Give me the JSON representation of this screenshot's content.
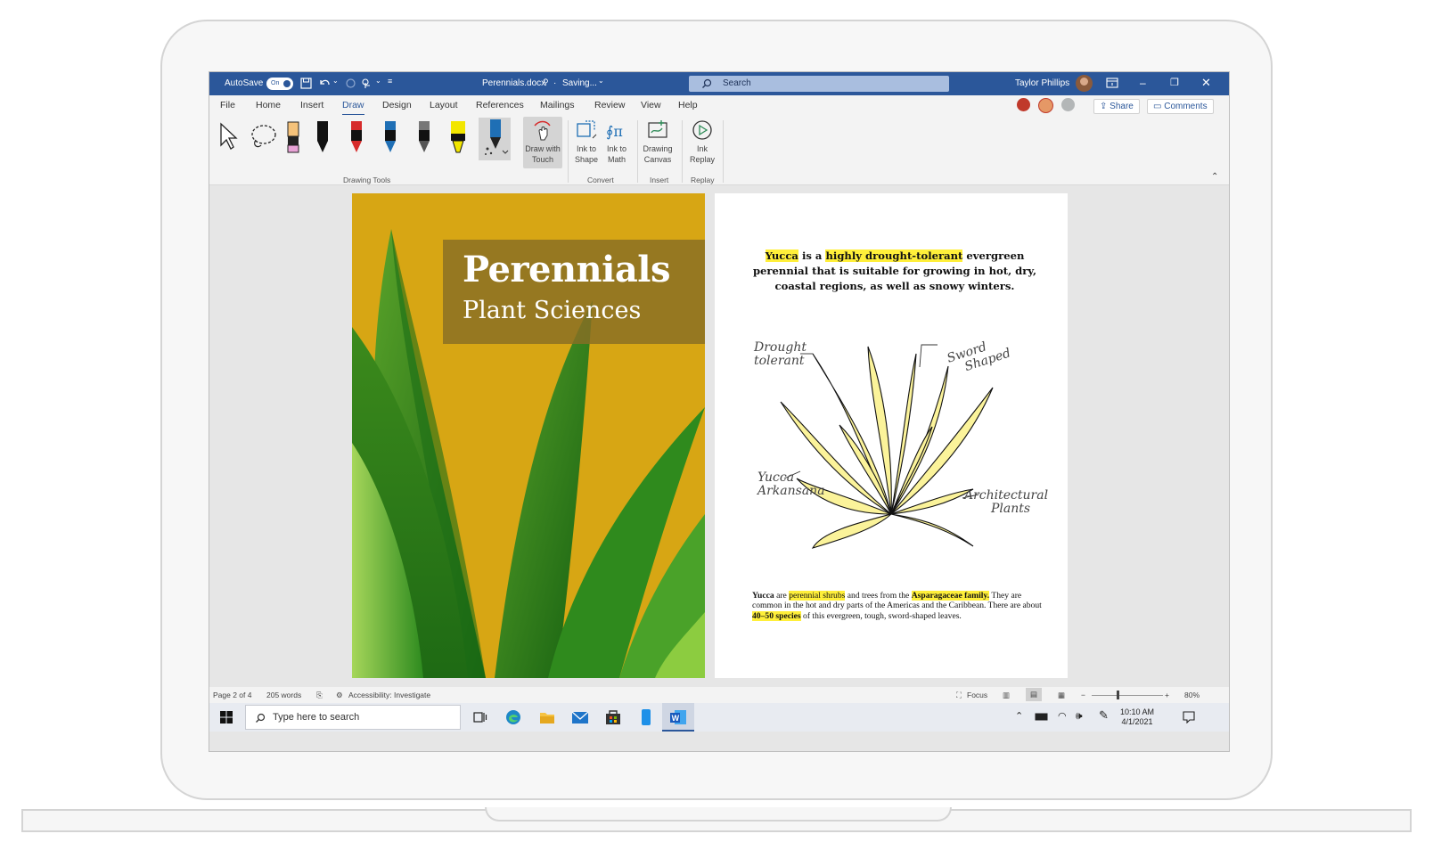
{
  "titlebar": {
    "autosave_label": "AutoSave",
    "autosave_state": "On",
    "doc_name": "Perennials.docx",
    "save_status": "Saving...",
    "search_placeholder": "Search",
    "user_name": "Taylor Phillips",
    "accent_color": "#2b579a"
  },
  "menu": {
    "items": [
      "File",
      "Home",
      "Insert",
      "Draw",
      "Design",
      "Layout",
      "References",
      "Mailings",
      "Review",
      "View",
      "Help"
    ],
    "active": "Draw",
    "share_label": "Share",
    "comments_label": "Comments"
  },
  "ribbon": {
    "draw_with_touch": [
      "Draw with",
      "Touch"
    ],
    "ink_to_shape": [
      "Ink to",
      "Shape"
    ],
    "ink_to_math": [
      "Ink to",
      "Math"
    ],
    "drawing_canvas": [
      "Drawing",
      "Canvas"
    ],
    "ink_replay": [
      "Ink",
      "Replay"
    ],
    "groups": {
      "drawing_tools": "Drawing Tools",
      "convert": "Convert",
      "insert": "Insert",
      "replay": "Replay"
    },
    "pen_colors": [
      "#f5c27a",
      "#111111",
      "#d62b2b",
      "#1f6fb5",
      "#555555",
      "#f2e600",
      "#1f6fb5"
    ]
  },
  "cover": {
    "title": "Perennials",
    "subtitle": "Plant Sciences"
  },
  "page2": {
    "head": {
      "hl1": "Yucca",
      "t1": " is a ",
      "hl2": "highly drought-tolerant",
      "t2": " evergreen perennial that is suitable for growing in hot, dry, coastal regions, as well as snowy winters."
    },
    "annotations": {
      "drought": [
        "Drought",
        "tolerant"
      ],
      "sword": [
        "Sword",
        "Shaped"
      ],
      "yucca": [
        "Yucca",
        "Arkansana"
      ],
      "arch": [
        "Architectural",
        "Plants"
      ]
    },
    "body": {
      "b1": "Yucca",
      "t1": " are ",
      "hl1": "perennial shrubs",
      "t2": " and trees from the ",
      "hl2": "Asparagaceae family.",
      "t3": " They are common in the hot and dry parts of the Americas and the Caribbean. There are about ",
      "hl3": "40–50 species",
      "t4": " of this evergreen, tough, sword-shaped leaves."
    }
  },
  "status": {
    "page": "Page 2 of 4",
    "words": "205 words",
    "accessibility": "Accessibility: Investigate",
    "focus": "Focus",
    "zoom": "80%"
  },
  "taskbar": {
    "search_placeholder": "Type here to search",
    "time": "10:10 AM",
    "date": "4/1/2021"
  }
}
